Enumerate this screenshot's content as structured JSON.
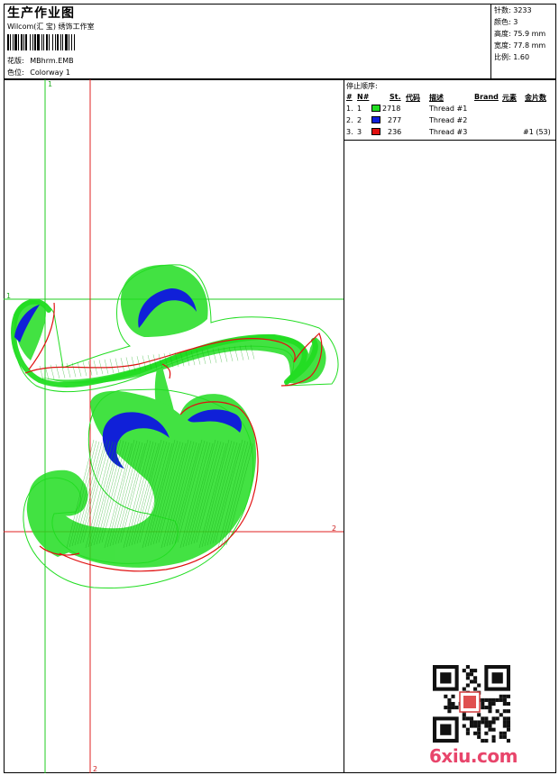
{
  "header": {
    "title": "生产作业图",
    "studio": "Wilcom(汇 宝) 绣饰工作室",
    "design_label": "花版:",
    "design_value": "MBhrm.EMB",
    "colorway_label": "色位:",
    "colorway_value": "Colorway 1"
  },
  "stats": [
    {
      "label": "针数:",
      "value": "3233"
    },
    {
      "label": "颜色:",
      "value": "3"
    },
    {
      "label": "高度:",
      "value": "75.9 mm"
    },
    {
      "label": "宽度:",
      "value": "77.8 mm"
    },
    {
      "label": "比例:",
      "value": "1.60"
    }
  ],
  "canvas": {
    "guide_labels": [
      "1",
      "1",
      "2",
      "2"
    ],
    "colors": {
      "green": "#22dd22",
      "blue": "#1020d8",
      "red": "#e01010",
      "guide_red": "#e02020",
      "guide_green": "#22cc22"
    }
  },
  "thread_table": {
    "title": "停止顺序:",
    "headers": {
      "num": "#",
      "n": "N#",
      "st": "St.",
      "code": "代码",
      "desc": "描述",
      "brand": "Brand",
      "element": "元素",
      "seq": "金片数"
    },
    "rows": [
      {
        "num": "1.",
        "n": "1",
        "color": "#22dd22",
        "st": "2718",
        "desc": "Thread #1",
        "extra": ""
      },
      {
        "num": "2.",
        "n": "2",
        "color": "#1020d8",
        "st": "277",
        "desc": "Thread #2",
        "extra": ""
      },
      {
        "num": "3.",
        "n": "3",
        "color": "#e01010",
        "st": "236",
        "desc": "Thread #3",
        "extra": "#1 (53)"
      }
    ]
  },
  "watermark": "6xiu.com",
  "qr_icon": "qr-code-icon"
}
